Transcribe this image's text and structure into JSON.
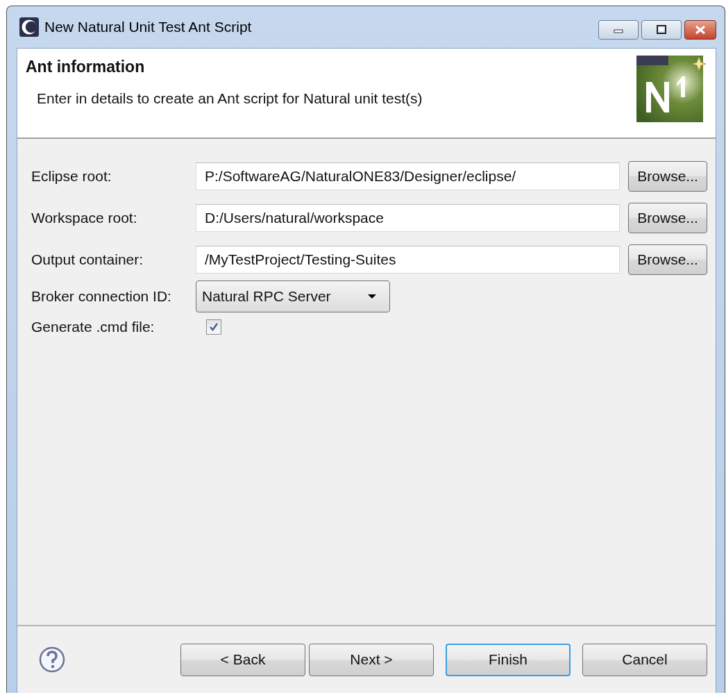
{
  "window": {
    "title": "New Natural Unit Test Ant Script"
  },
  "header": {
    "title": "Ant information",
    "description": "Enter in details to create an Ant script for Natural unit test(s)"
  },
  "fields": [
    {
      "kind": "text",
      "label": "Eclipse root:",
      "value": "P:/SoftwareAG/NaturalONE83/Designer/eclipse/",
      "button": "Browse..."
    },
    {
      "kind": "text",
      "label": "Workspace root:",
      "value": "D:/Users/natural/workspace",
      "button": "Browse..."
    },
    {
      "kind": "text",
      "label": "Output container:",
      "value": "/MyTestProject/Testing-Suites",
      "button": "Browse..."
    },
    {
      "kind": "combo",
      "label": "Broker connection ID:",
      "value": "Natural RPC Server"
    },
    {
      "kind": "checkbox",
      "label": "Generate .cmd file:",
      "checked": true
    }
  ],
  "buttons": [
    {
      "label": "< Back",
      "default": false
    },
    {
      "label": "Next >",
      "default": false
    },
    {
      "label": "Finish",
      "default": true
    },
    {
      "label": "Cancel",
      "default": false
    }
  ]
}
